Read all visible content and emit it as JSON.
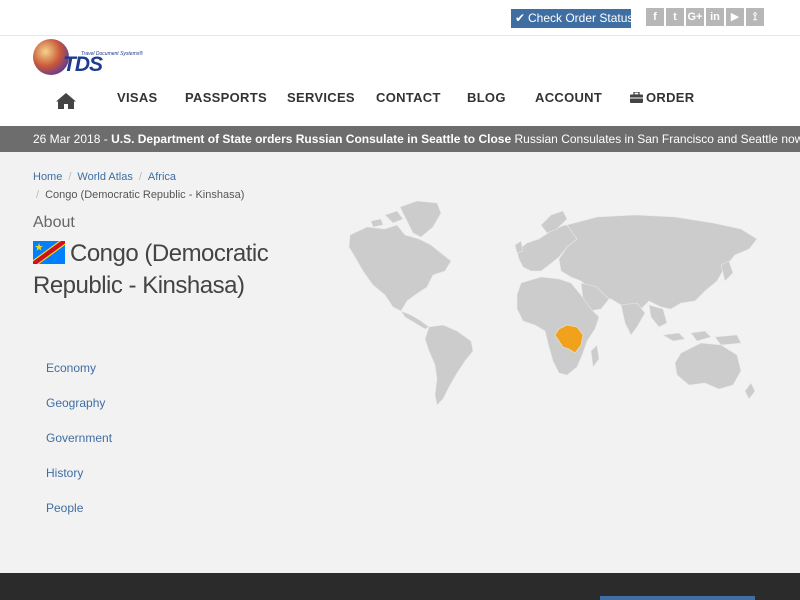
{
  "topbar": {
    "order_status": "Check Order Status",
    "social": [
      {
        "icon": "facebook-icon",
        "glyph": "f"
      },
      {
        "icon": "twitter-icon",
        "glyph": "t"
      },
      {
        "icon": "google-plus-icon",
        "glyph": "G+"
      },
      {
        "icon": "linkedin-icon",
        "glyph": "in"
      },
      {
        "icon": "youtube-icon",
        "glyph": "▶"
      },
      {
        "icon": "rss-icon",
        "glyph": "⟟"
      }
    ]
  },
  "logo": {
    "text": "TDS",
    "tagline": "Travel Document Systems®"
  },
  "nav": [
    {
      "label": "VISAS"
    },
    {
      "label": "PASSPORTS"
    },
    {
      "label": "SERVICES"
    },
    {
      "label": "CONTACT"
    },
    {
      "label": "BLOG"
    },
    {
      "label": "ACCOUNT"
    },
    {
      "label": "ORDER"
    }
  ],
  "ticker": {
    "date": "26 Mar 2018 -",
    "headline": "U.S. Department of State orders Russian Consulate in Seattle to Close",
    "summary": "Russian Consulates in San Francisco and Seattle now ..."
  },
  "breadcrumb": {
    "items": [
      "Home",
      "World Atlas",
      "Africa"
    ],
    "current": "Congo (Democratic Republic - Kinshasa)"
  },
  "about": "About",
  "country": {
    "name": "Congo (Democratic Republic - Kinshasa)"
  },
  "sidebar": [
    "Economy",
    "Geography",
    "Government",
    "History",
    "People"
  ],
  "colors": {
    "accent": "#3f6ea3",
    "ticker_bg": "#6d6d6d",
    "highlight_country": "#f0a21c",
    "map_land": "#cccccc"
  }
}
